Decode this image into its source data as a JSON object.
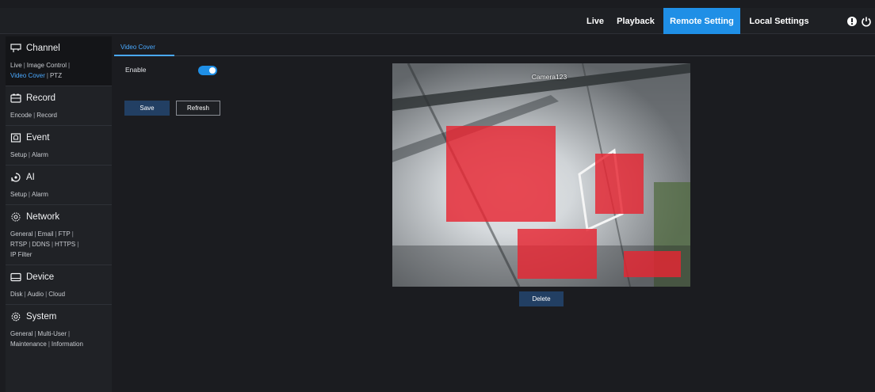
{
  "topnav": {
    "live": "Live",
    "playback": "Playback",
    "remote_setting": "Remote Setting",
    "local_settings": "Local Settings"
  },
  "icons": {
    "info": "info-icon",
    "power": "power-icon"
  },
  "colors": {
    "accent": "#1f8fe6",
    "link_active": "#4aa9ff",
    "mask": "#e62632"
  },
  "sidebar": {
    "channel": {
      "title": "Channel",
      "links": [
        "Live",
        "Image Control",
        "Video Cover",
        "PTZ"
      ],
      "selected": "Video Cover"
    },
    "record": {
      "title": "Record",
      "links": [
        "Encode",
        "Record"
      ]
    },
    "event": {
      "title": "Event",
      "links": [
        "Setup",
        "Alarm"
      ]
    },
    "ai": {
      "title": "AI",
      "links": [
        "Setup",
        "Alarm"
      ]
    },
    "network": {
      "title": "Network",
      "links": [
        "General",
        "Email",
        "FTP",
        "RTSP",
        "DDNS",
        "HTTPS",
        "IP Filter"
      ]
    },
    "device": {
      "title": "Device",
      "links": [
        "Disk",
        "Audio",
        "Cloud"
      ]
    },
    "system": {
      "title": "System",
      "links": [
        "General",
        "Multi-User",
        "Maintenance",
        "Information"
      ]
    }
  },
  "main": {
    "tab": "Video Cover",
    "enable_label": "Enable",
    "enable_on": true,
    "save": "Save",
    "refresh": "Refresh",
    "delete": "Delete",
    "camera_label": "Camera123",
    "cover_areas": 4
  }
}
